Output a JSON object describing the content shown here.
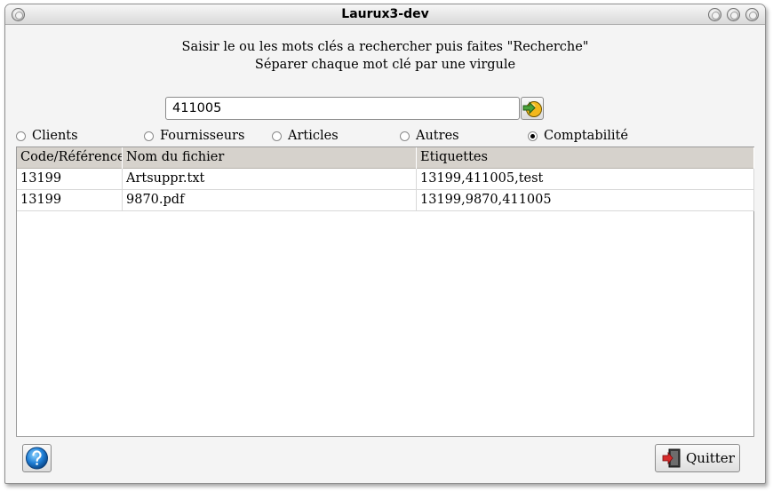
{
  "window": {
    "title": "Laurux3-dev"
  },
  "instructions": {
    "line1": "Saisir le ou les mots clés a rechercher puis faites \"Recherche\"",
    "line2": "Séparer chaque mot clé par une virgule"
  },
  "search": {
    "value": "411005"
  },
  "categories": [
    {
      "label": "Clients",
      "checked": false
    },
    {
      "label": "Fournisseurs",
      "checked": false
    },
    {
      "label": "Articles",
      "checked": false
    },
    {
      "label": "Autres",
      "checked": false
    },
    {
      "label": "Comptabilité",
      "checked": true
    }
  ],
  "table": {
    "headers": [
      "Code/Référence",
      "Nom du fichier",
      "Etiquettes"
    ],
    "rows": [
      [
        "13199",
        "Artsuppr.txt",
        "13199,411005,test"
      ],
      [
        "13199",
        "9870.pdf",
        "13199,9870,411005"
      ]
    ]
  },
  "buttons": {
    "quit_label": "Quitter"
  },
  "icons": {
    "search": "go-arrow-icon",
    "help": "help-icon",
    "quit": "exit-door-icon"
  }
}
